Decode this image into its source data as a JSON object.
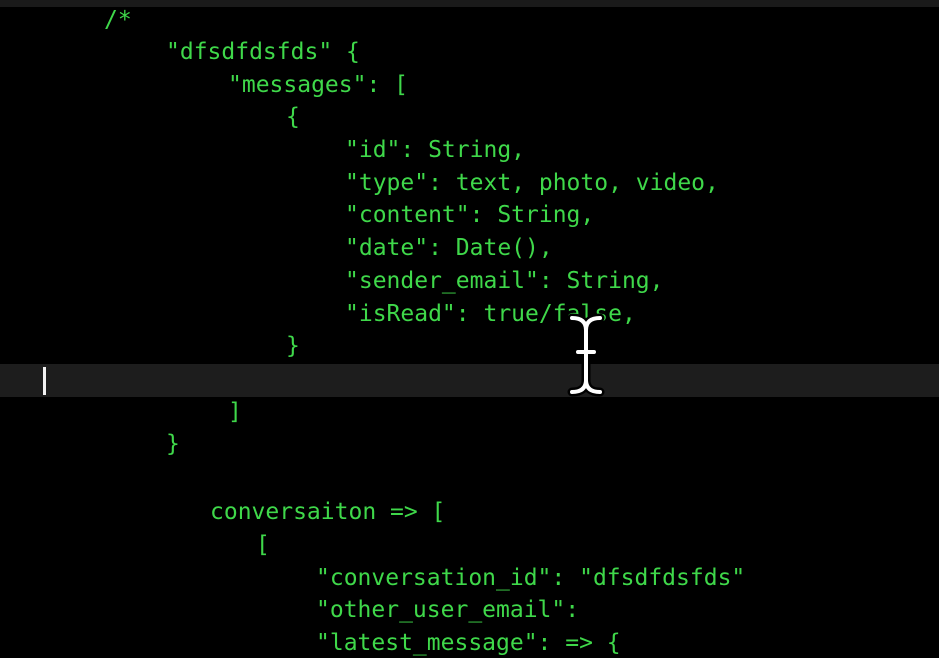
{
  "editor": {
    "text_color": "#3fd84a",
    "current_line_color": "#1d1d1d",
    "lines": [
      "/*",
      "\"dfsdfdsfds\" {",
      "\"messages\": [",
      "{",
      "\"id\": String,",
      "\"type\": text, photo, video,",
      "\"content\": String,",
      "\"date\": Date(),",
      "\"sender_email\": String,",
      "\"isRead\": true/false,",
      "}",
      "",
      "]",
      "}",
      "conversaiton => [",
      "[",
      "\"conversation_id\": \"dfsdfdsfds\"",
      "\"other_user_email\":",
      "\"latest_message\": => {"
    ]
  },
  "icons": {
    "text_cursor": "caret-icon",
    "mouse_pointer": "ibeam-cursor-icon"
  }
}
